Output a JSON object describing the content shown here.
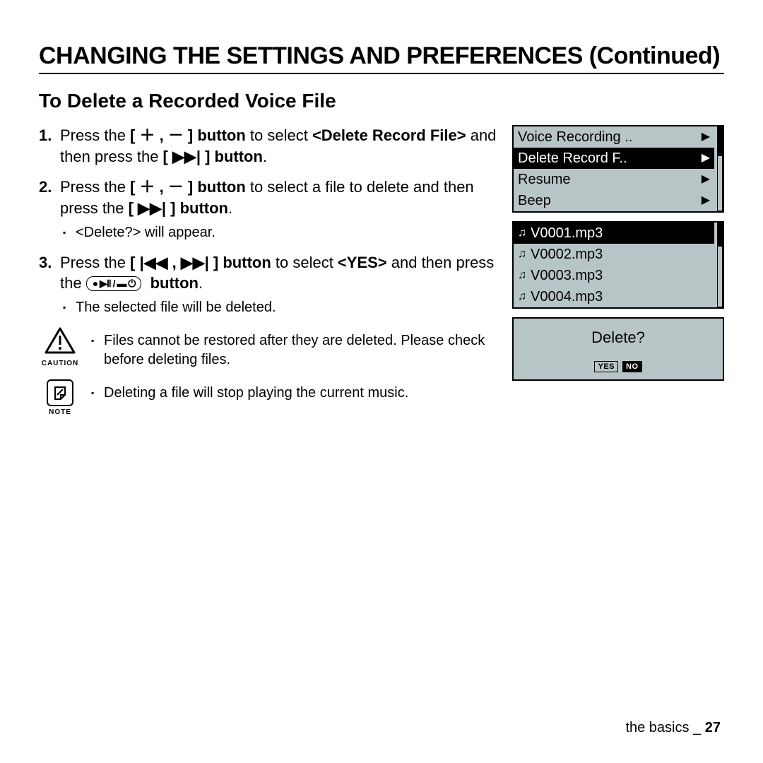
{
  "page": {
    "title": "CHANGING THE SETTINGS AND PREFERENCES (Continued)",
    "section": "To Delete a Recorded Voice File",
    "footer_section": "the basics",
    "footer_sep": " _ ",
    "footer_page": "27"
  },
  "steps": {
    "s1a": "Press the ",
    "s1b": "[ ＋ , － ] button",
    "s1c": " to select ",
    "s1d": "<Delete Record File>",
    "s1e": " and then press the ",
    "s1f": "[ ▶▶| ] button",
    "s1g": ".",
    "s2a": "Press the ",
    "s2b": "[ ＋ , － ] button",
    "s2c": " to select a file to delete and then press the ",
    "s2d": "[ ▶▶| ] button",
    "s2e": ".",
    "s2sub": "<Delete?> will appear.",
    "s3a": "Press the ",
    "s3b": "[ |◀◀ , ▶▶| ] button",
    "s3c": " to select ",
    "s3d": "<YES>",
    "s3e": " and then press the ",
    "s3btn": "● ▶Ⅱ / ▬ ⏻",
    "s3f": "button",
    "s3g": ".",
    "s3sub": "The selected file will be deleted."
  },
  "caution": {
    "label": "CAUTION",
    "text": "Files cannot be restored after they are deleted. Please check before deleting files."
  },
  "note": {
    "label": "NOTE",
    "text": "Deleting a file will stop playing the current music."
  },
  "menu_screen": {
    "items": [
      {
        "label": "Voice Recording ..",
        "selected": false
      },
      {
        "label": "Delete Record F..",
        "selected": true
      },
      {
        "label": "Resume",
        "selected": false
      },
      {
        "label": "Beep",
        "selected": false
      }
    ]
  },
  "file_screen": {
    "items": [
      {
        "label": "V0001.mp3",
        "selected": true
      },
      {
        "label": "V0002.mp3",
        "selected": false
      },
      {
        "label": "V0003.mp3",
        "selected": false
      },
      {
        "label": "V0004.mp3",
        "selected": false
      }
    ]
  },
  "confirm": {
    "question": "Delete?",
    "yes": "YES",
    "no": "NO"
  }
}
